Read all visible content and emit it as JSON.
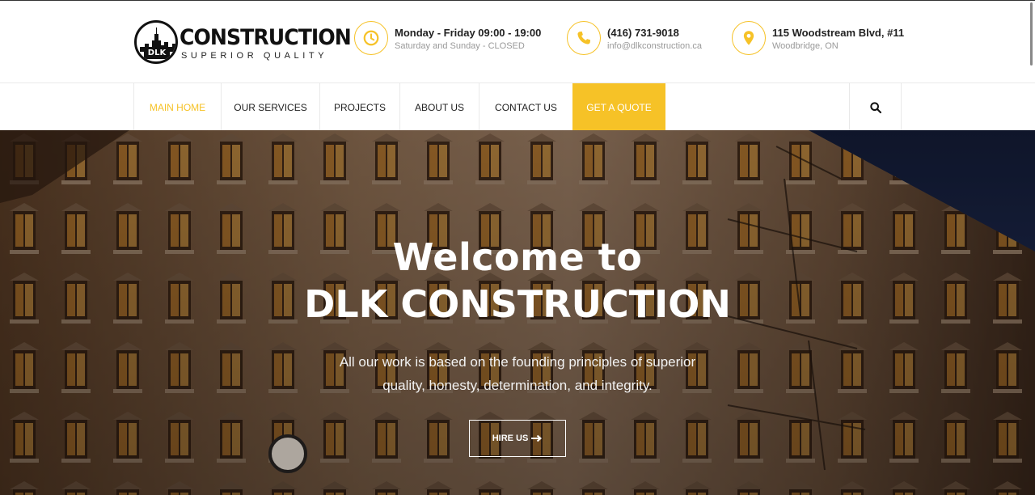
{
  "brand": {
    "mark_text": "DLK",
    "name": "CONSTRUCTION",
    "tagline": "SUPERIOR QUALITY"
  },
  "contact": {
    "hours": {
      "title": "Monday - Friday 09:00 - 19:00",
      "subtitle": "Saturday and Sunday - CLOSED",
      "icon": "clock-icon"
    },
    "phone": {
      "title": "(416) 731-9018",
      "subtitle": "info@dlkconstruction.ca",
      "icon": "phone-icon"
    },
    "address": {
      "title": "115 Woodstream Blvd, #11",
      "subtitle": "Woodbridge, ON",
      "icon": "location-pin-icon"
    }
  },
  "nav": {
    "items": [
      {
        "label": "MAIN HOME",
        "active": true
      },
      {
        "label": "OUR SERVICES"
      },
      {
        "label": "PROJECTS"
      },
      {
        "label": "ABOUT US"
      },
      {
        "label": "CONTACT US"
      },
      {
        "label": "GET A QUOTE"
      }
    ],
    "search_icon": "search-icon"
  },
  "hero": {
    "heading_line1": "Welcome to",
    "heading_line2": "DLK CONSTRUCTION",
    "text_line1": "All our work is based on the founding principles of superior",
    "text_line2": "quality, honesty, determination, and integrity.",
    "button": "HIRE US",
    "button_icon": "arrow-right-icon"
  },
  "colors": {
    "accent": "#f6c227",
    "text_dark": "#222222",
    "text_muted": "#999999"
  }
}
